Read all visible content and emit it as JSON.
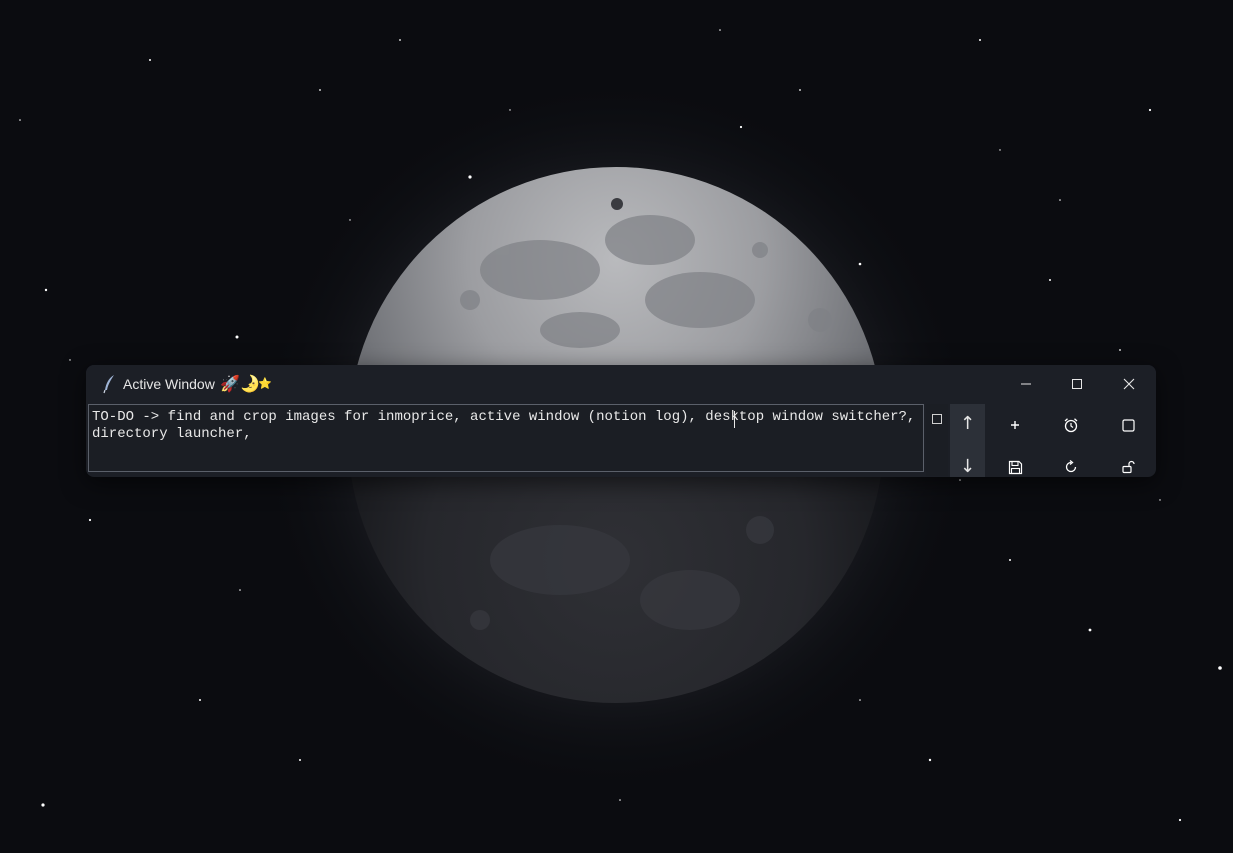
{
  "window": {
    "title": "Active Window",
    "title_emojis": [
      "🚀",
      "🌛",
      "⭐"
    ],
    "app_icon": "quill-pen-icon"
  },
  "window_controls": {
    "minimize": "minimize-icon",
    "maximize": "maximize-icon",
    "close": "close-icon"
  },
  "editor": {
    "text": "TO-DO -> find and crop images for inmoprice, active window (notion log), desktop window switcher?, directory launcher,"
  },
  "navigation": {
    "up": "↑",
    "down": "↓"
  },
  "toolbar": {
    "add_icon": "plus-icon",
    "alarm_icon": "alarm-clock-icon",
    "square_icon": "square-icon",
    "save_icon": "floppy-disk-icon",
    "refresh_icon": "refresh-icon",
    "lock_icon": "unlock-icon"
  },
  "colors": {
    "window_bg": "#1c1f26",
    "editor_border": "#5b606a",
    "nav_bg": "#2c3038",
    "text": "#e9e9e9"
  }
}
